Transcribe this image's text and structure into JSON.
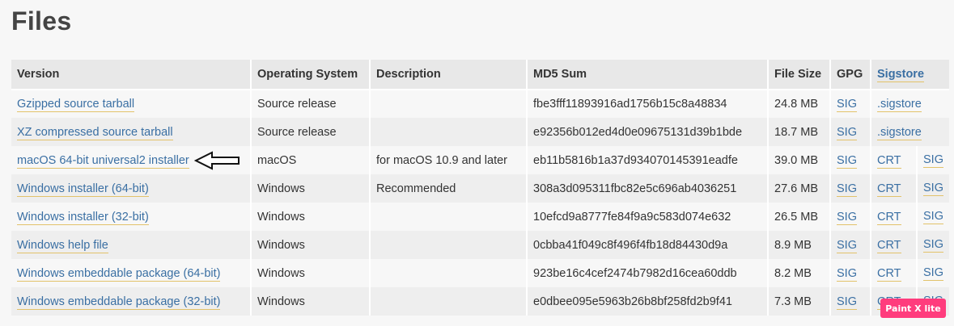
{
  "page": {
    "title": "Files"
  },
  "table": {
    "headers": [
      "Version",
      "Operating System",
      "Description",
      "MD5 Sum",
      "File Size",
      "GPG",
      "Sigstore"
    ],
    "rows": [
      {
        "version": "Gzipped source tarball",
        "os": "Source release",
        "description": "",
        "md5": "fbe3fff11893916ad1756b15c8a48834",
        "size": "24.8 MB",
        "gpg": "SIG",
        "sig_a": ".sigstore",
        "sig_b": ""
      },
      {
        "version": "XZ compressed source tarball",
        "os": "Source release",
        "description": "",
        "md5": "e92356b012ed4d0e09675131d39b1bde",
        "size": "18.7 MB",
        "gpg": "SIG",
        "sig_a": ".sigstore",
        "sig_b": ""
      },
      {
        "version": "macOS 64-bit universal2 installer",
        "os": "macOS",
        "description": "for macOS 10.9 and later",
        "md5": "eb11b5816b1a37d934070145391eadfe",
        "size": "39.0 MB",
        "gpg": "SIG",
        "sig_a": "CRT",
        "sig_b": "SIG"
      },
      {
        "version": "Windows installer (64-bit)",
        "os": "Windows",
        "description": "Recommended",
        "md5": "308a3d095311fbc82e5c696ab4036251",
        "size": "27.6 MB",
        "gpg": "SIG",
        "sig_a": "CRT",
        "sig_b": "SIG"
      },
      {
        "version": "Windows installer (32-bit)",
        "os": "Windows",
        "description": "",
        "md5": "10efcd9a8777fe84f9a9c583d074e632",
        "size": "26.5 MB",
        "gpg": "SIG",
        "sig_a": "CRT",
        "sig_b": "SIG"
      },
      {
        "version": "Windows help file",
        "os": "Windows",
        "description": "",
        "md5": "0cbba41f049c8f496f4fb18d84430d9a",
        "size": "8.9 MB",
        "gpg": "SIG",
        "sig_a": "CRT",
        "sig_b": "SIG"
      },
      {
        "version": "Windows embeddable package (64-bit)",
        "os": "Windows",
        "description": "",
        "md5": "923be16c4cef2474b7982d16cea60ddb",
        "size": "8.2 MB",
        "gpg": "SIG",
        "sig_a": "CRT",
        "sig_b": "SIG"
      },
      {
        "version": "Windows embeddable package (32-bit)",
        "os": "Windows",
        "description": "",
        "md5": "e0dbee095e5963b26b8bf258fd2b9f41",
        "size": "7.3 MB",
        "gpg": "SIG",
        "sig_a": "CRT",
        "sig_b": "SIG"
      }
    ]
  },
  "annotation": {
    "icon": "left-arrow-icon"
  },
  "watermark": {
    "text": "Paint X lite"
  },
  "colors": {
    "link": "#3a6fa3",
    "link_underline": "#e2c26a",
    "header_bg": "#e8e8e8",
    "watermark_bg": "#ff3c7d"
  }
}
